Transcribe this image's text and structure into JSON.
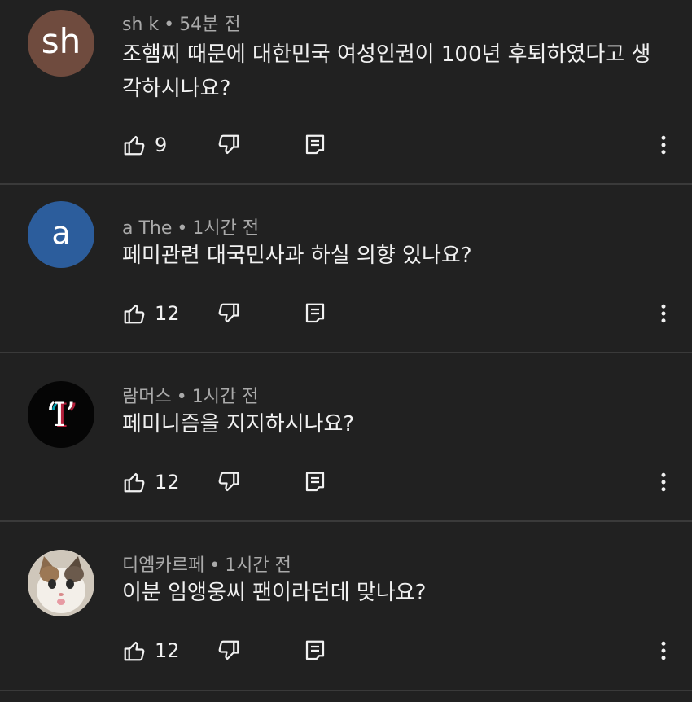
{
  "comments": [
    {
      "author": "sh k",
      "time": "54분 전",
      "text": "조햄찌 때문에 대한민국 여성인권이 100년 후퇴하였다고 생각하시나요?",
      "likes": "9",
      "avatar_letter": "sh",
      "avatar_color": "#6f4b3e"
    },
    {
      "author": "a The",
      "time": "1시간 전",
      "text": "페미관련 대국민사과 하실 의향 있나요?",
      "likes": "12",
      "avatar_letter": "a",
      "avatar_color": "#2c5d9c"
    },
    {
      "author": "람머스",
      "time": "1시간 전",
      "text": "페미니즘을 지지하시나요?",
      "likes": "12",
      "avatar_letter": "‘I’",
      "avatar_color": "#050505"
    },
    {
      "author": "디엠카르페",
      "time": "1시간 전",
      "text": "이분 임앵웅씨 팬이라던데 맞나요?",
      "likes": "12",
      "avatar_color": "#d9d4cc"
    }
  ],
  "separator": "•",
  "icons": {
    "like": "thumb-up-icon",
    "dislike": "thumb-down-icon",
    "reply": "reply-icon",
    "more": "more-vert-icon"
  },
  "colors": {
    "background": "#212121",
    "primary_text": "#f1f1f1",
    "secondary_text": "#aaaaaa",
    "divider": "#3a3a3a"
  }
}
